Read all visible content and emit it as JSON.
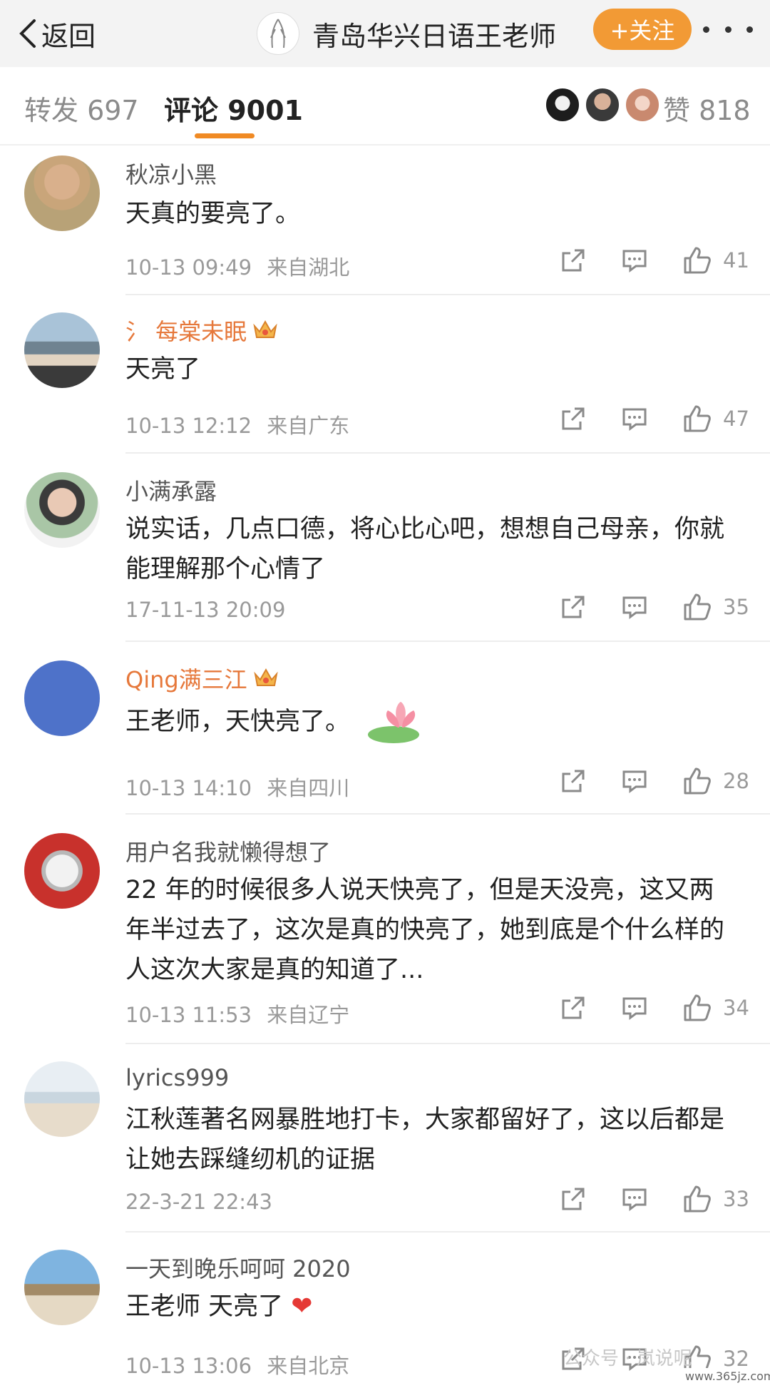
{
  "header": {
    "back_label": "返回",
    "title": "青岛华兴日语王老师",
    "follow_label": "+关注"
  },
  "tabs": {
    "repost": "转发 697",
    "comments": "评论 9001",
    "likes": "赞 818"
  },
  "comments": [
    {
      "name": "秋凉小黑",
      "text": "天真的要亮了。",
      "time": "10-13 09:49",
      "location": "来自湖北",
      "likes": "41"
    },
    {
      "name": "氵 每棠未眠",
      "text": "天亮了",
      "time": "10-13 12:12",
      "location": "来自广东",
      "likes": "47"
    },
    {
      "name": "小满承露",
      "text": "说实话，几点口德，将心比心吧，想想自己母亲，你就能理解那个心情了",
      "time": "17-11-13 20:09",
      "location": "",
      "likes": "35"
    },
    {
      "name": "Qing满三江",
      "text": "王老师，天快亮了。",
      "time": "10-13 14:10",
      "location": "来自四川",
      "likes": "28"
    },
    {
      "name": "用户名我就懒得想了",
      "text": "22 年的时候很多人说天快亮了，但是天没亮，这又两年半过去了，这次是真的快亮了，她到底是个什么样的人这次大家是真的知道了...",
      "time": "10-13 11:53",
      "location": "来自辽宁",
      "likes": "34"
    },
    {
      "name": "lyrics999",
      "text": "江秋莲著名网暴胜地打卡，大家都留好了，这以后都是让她去踩缝纫机的证据",
      "time": "22-3-21 22:43",
      "location": "",
      "likes": "33"
    },
    {
      "name": "一天到晚乐呵呵 2020",
      "text": "王老师 天亮了",
      "time": "10-13 13:06",
      "location": "来自北京",
      "likes": "32"
    }
  ],
  "watermark": "公众号 · 岚说呢",
  "site_mark": "www.365jz.com",
  "colors": {
    "accent": "#f29a35",
    "vip_name": "#e6783b",
    "heart": "#e53935"
  }
}
